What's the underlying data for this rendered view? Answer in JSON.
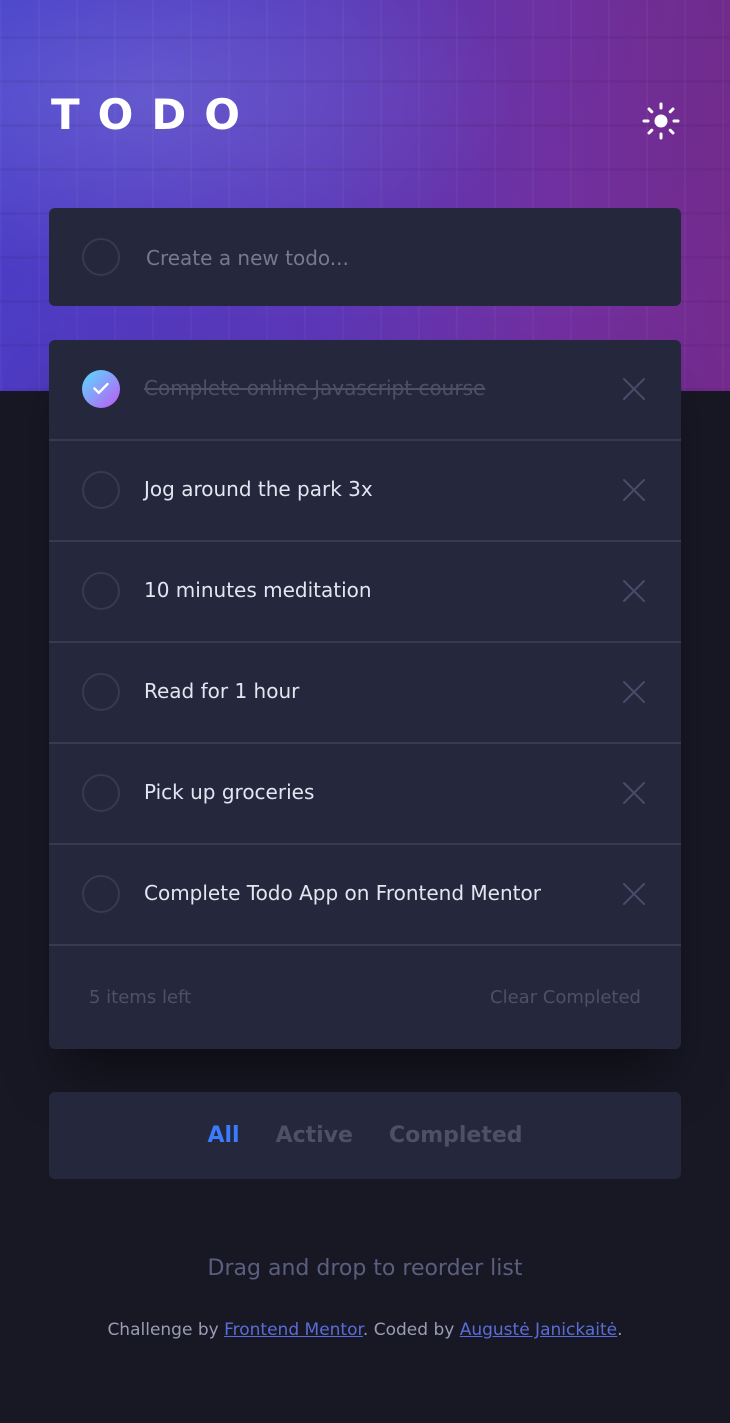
{
  "header": {
    "title": "TODO",
    "theme_icon": "sun-icon"
  },
  "new_todo": {
    "placeholder": "Create a new todo..."
  },
  "todos": [
    {
      "text": "Complete online Javascript course",
      "completed": true
    },
    {
      "text": "Jog around the park 3x",
      "completed": false
    },
    {
      "text": "10 minutes meditation",
      "completed": false
    },
    {
      "text": "Read for 1 hour",
      "completed": false
    },
    {
      "text": "Pick up groceries",
      "completed": false
    },
    {
      "text": "Complete Todo App on Frontend Mentor",
      "completed": false
    }
  ],
  "footer": {
    "items_left": "5 items left",
    "clear_completed": "Clear Completed"
  },
  "filters": {
    "all": "All",
    "active": "Active",
    "completed": "Completed",
    "selected": "All"
  },
  "hint": "Drag and drop to reorder list",
  "attribution": {
    "prefix": "Challenge by ",
    "link1": "Frontend Mentor",
    "middle": ". Coded by ",
    "link2": "Augustė Janickaitė",
    "suffix": "."
  },
  "colors": {
    "page_bg": "#171824",
    "card_bg": "#25273c",
    "active_filter": "#3a7cfd",
    "check_gradient_start": "#57ddff",
    "check_gradient_end": "#c058f3",
    "link": "#5a6cd8"
  }
}
